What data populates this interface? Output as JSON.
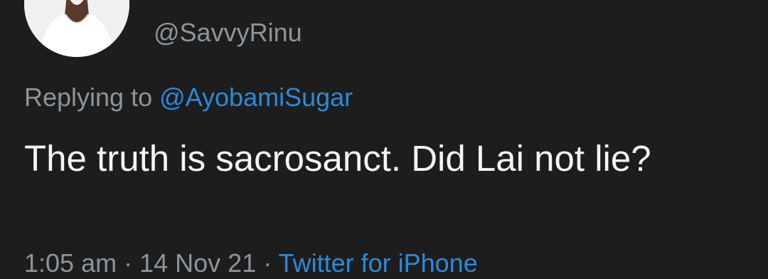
{
  "tweet": {
    "handle": "@SavvyRinu",
    "reply_prefix": "Replying to",
    "reply_to": "@AyobamiSugar",
    "text": "The truth is sacrosanct. Did Lai not lie?",
    "meta_time": "1:05 am",
    "meta_separator": "·",
    "meta_date": "14 Nov 21",
    "meta_via": "·",
    "source": "Twitter for iPhone"
  },
  "colors": {
    "background": "#1d1d1d",
    "secondary_text": "#8c949c",
    "link": "#2b8ad8",
    "primary_text": "#f5f5f5"
  }
}
